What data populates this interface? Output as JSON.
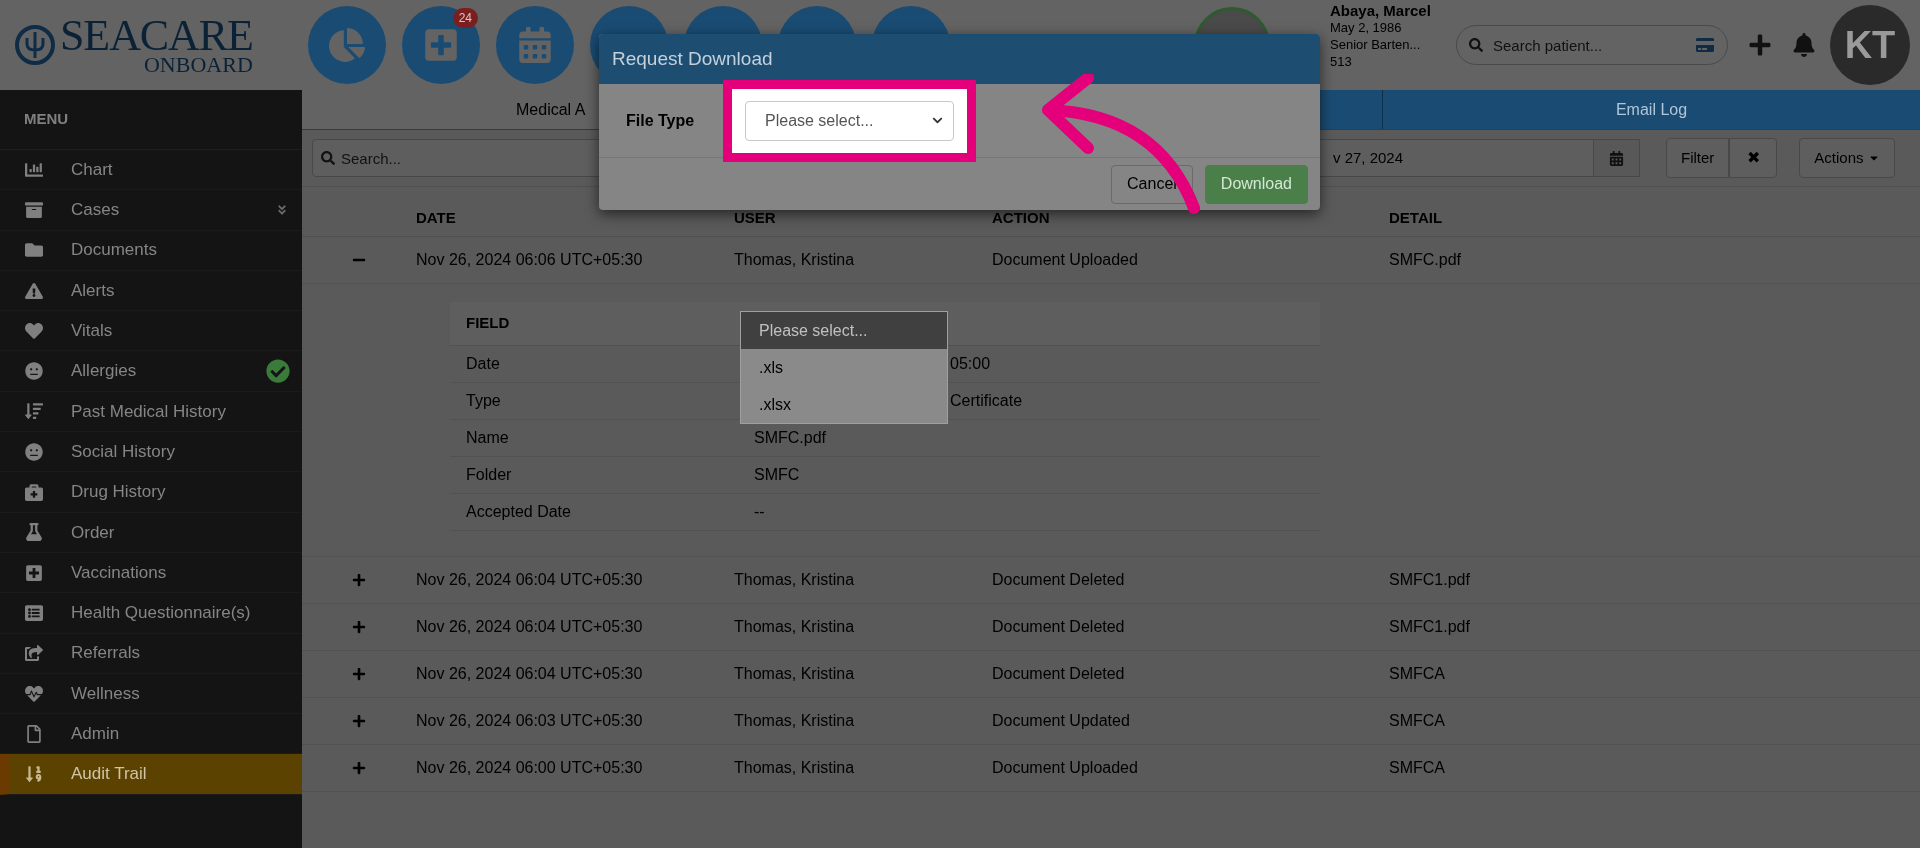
{
  "logo": {
    "name": "SEACARE",
    "sub": "ONBOARD"
  },
  "header_buttons": [
    {
      "kind": "plain"
    },
    {
      "kind": "badged",
      "badge": "24"
    },
    {
      "kind": "plain"
    },
    {
      "kind": "plain"
    },
    {
      "kind": "plain"
    },
    {
      "kind": "plain"
    },
    {
      "kind": "plain"
    }
  ],
  "patient": {
    "name": "Abaya, Marcel",
    "lines": [
      "May 2, 1986",
      "Senior Barten...",
      "513"
    ]
  },
  "patient_search": {
    "placeholder": "Search patient..."
  },
  "user_avatar": "KT",
  "menu": {
    "title": "MENU",
    "items": [
      {
        "label": "Chart",
        "selected": false,
        "verified": false
      },
      {
        "label": "Cases",
        "selected": false,
        "verified": false
      },
      {
        "label": "Documents",
        "selected": false,
        "verified": false
      },
      {
        "label": "Alerts",
        "selected": false,
        "verified": false
      },
      {
        "label": "Vitals",
        "selected": false,
        "verified": false
      },
      {
        "label": "Allergies",
        "selected": false,
        "verified": true
      },
      {
        "label": "Past Medical History",
        "selected": false,
        "verified": false
      },
      {
        "label": "Social History",
        "selected": false,
        "verified": false
      },
      {
        "label": "Drug History",
        "selected": false,
        "verified": false
      },
      {
        "label": "Order",
        "selected": false,
        "verified": false
      },
      {
        "label": "Vaccinations",
        "selected": false,
        "verified": false
      },
      {
        "label": "Health Questionnaire(s)",
        "selected": false,
        "verified": false
      },
      {
        "label": "Referrals",
        "selected": false,
        "verified": false
      },
      {
        "label": "Wellness",
        "selected": false,
        "verified": false
      },
      {
        "label": "Admin",
        "selected": false,
        "verified": false
      },
      {
        "label": "Audit Trail",
        "selected": true,
        "verified": false
      }
    ]
  },
  "tabs": [
    {
      "label": "Medical A",
      "selected": true
    },
    {
      "label": "Email Log",
      "selected": false
    }
  ],
  "toolbar": {
    "search_placeholder": "Search...",
    "date_value": "v 27, 2024",
    "filter": "Filter",
    "clear": "✖",
    "actions": "Actions"
  },
  "table": {
    "columns": [
      "DATE",
      "USER",
      "ACTION",
      "DETAIL"
    ],
    "rows": [
      {
        "expanded": true,
        "cells": [
          "Nov 26, 2024 06:06 UTC+05:30",
          "Thomas, Kristina",
          "Document Uploaded",
          "SMFC.pdf"
        ],
        "details": {
          "columns": [
            "FIELD"
          ],
          "rows": [
            {
              "field": "Date",
              "value": "05:00",
              "partly_covered": true
            },
            {
              "field": "Type",
              "value": "Certificate",
              "partly_covered": true
            },
            {
              "field": "Name",
              "value": "SMFC.pdf",
              "partly_covered": false
            },
            {
              "field": "Folder",
              "value": "SMFC",
              "partly_covered": false
            },
            {
              "field": "Accepted Date",
              "value": "--",
              "partly_covered": false
            }
          ]
        }
      },
      {
        "expanded": false,
        "cells": [
          "Nov 26, 2024 06:04 UTC+05:30",
          "Thomas, Kristina",
          "Document Deleted",
          "SMFC1.pdf"
        ]
      },
      {
        "expanded": false,
        "cells": [
          "Nov 26, 2024 06:04 UTC+05:30",
          "Thomas, Kristina",
          "Document Deleted",
          "SMFC1.pdf"
        ]
      },
      {
        "expanded": false,
        "cells": [
          "Nov 26, 2024 06:04 UTC+05:30",
          "Thomas, Kristina",
          "Document Deleted",
          "SMFCA"
        ]
      },
      {
        "expanded": false,
        "cells": [
          "Nov 26, 2024 06:03 UTC+05:30",
          "Thomas, Kristina",
          "Document Updated",
          "SMFCA"
        ]
      },
      {
        "expanded": false,
        "cells": [
          "Nov 26, 2024 06:00 UTC+05:30",
          "Thomas, Kristina",
          "Document Uploaded",
          "SMFCA"
        ]
      }
    ]
  },
  "select_list": {
    "options": [
      {
        "label": "Please select...",
        "selected": true
      },
      {
        "label": ".xls",
        "selected": false
      },
      {
        "label": ".xlsx",
        "selected": false
      }
    ]
  },
  "dialog": {
    "title": "Request Download",
    "field_label": "File Type",
    "select_value": "Please select...",
    "buttons": [
      {
        "label": "Cancel",
        "kind": "secondary"
      },
      {
        "label": "Download",
        "kind": "primary"
      }
    ]
  }
}
